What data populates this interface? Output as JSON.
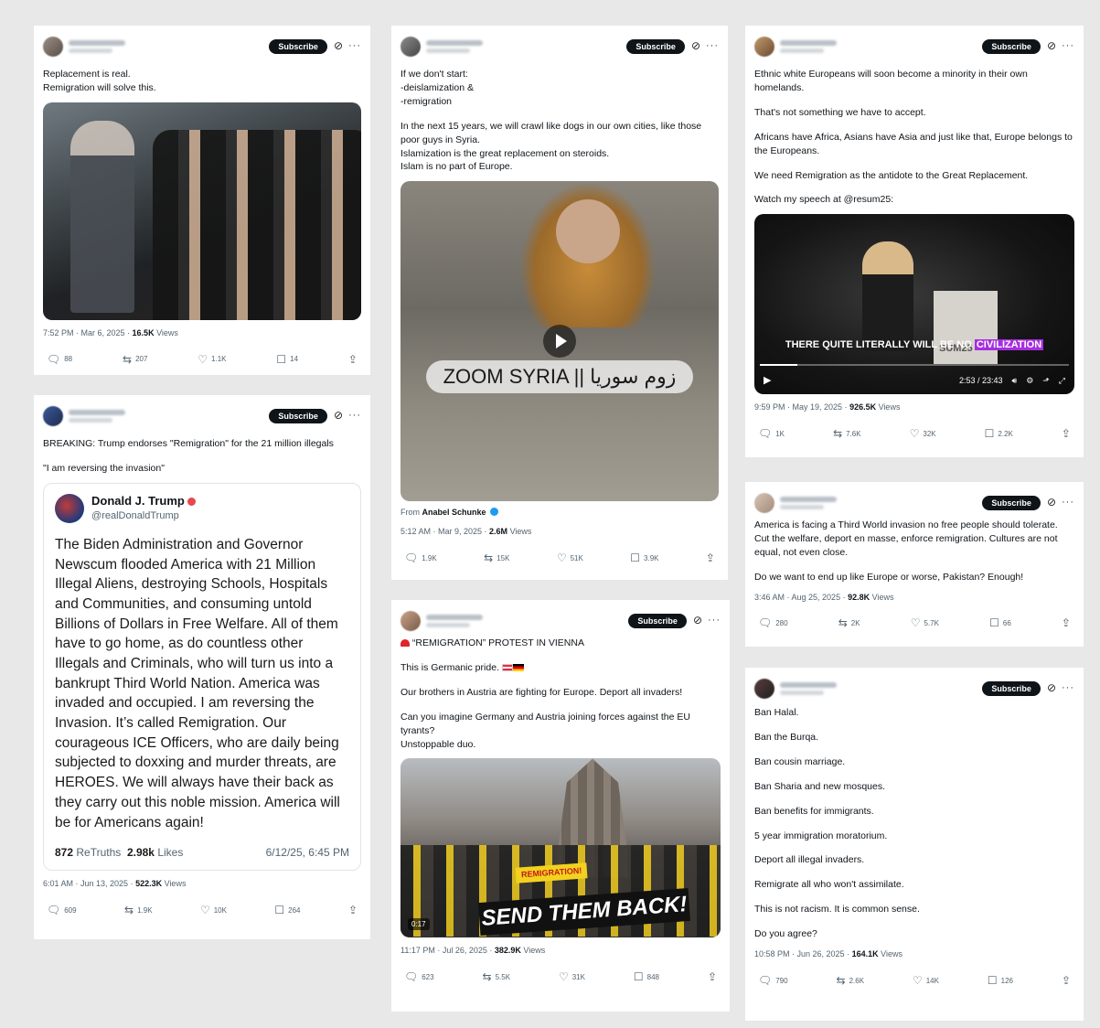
{
  "common": {
    "subscribe": "Subscribe",
    "grok_icon": "⊘",
    "more_icon": "···"
  },
  "post1": {
    "lines": [
      "Replacement is real.",
      "Remigration will solve this."
    ],
    "time": "7:52 PM · Mar 6, 2025 · ",
    "views": "16.5K",
    "views_label": " Views",
    "replies": "88",
    "reposts": "207",
    "likes": "1.1K",
    "bookmarks": "14"
  },
  "post2": {
    "line1": "BREAKING: Trump endorses \"Remigration\" for the 21 million illegals",
    "line2": "\"I am reversing the invasion\"",
    "truth_name": "Donald J. Trump",
    "truth_handle": "@realDonaldTrump",
    "truth_text": "The Biden Administration and Governor Newscum flooded America with 21 Million Illegal Aliens, destroying Schools, Hospitals and Communities, and consuming untold Billions of Dollars in Free Welfare. All of them have to go home, as do countless other Illegals and Criminals, who will turn us into a bankrupt Third World Nation. America was invaded and occupied. I am reversing the Invasion. It’s called Remigration. Our courageous ICE Officers, who are daily being subjected to doxxing and murder threats, are HEROES. We will always have their back as they carry out this noble mission. America will be for Americans again!",
    "retruths": "872",
    "retruths_label": " ReTruths",
    "truth_likes": "2.98k",
    "truth_likes_label": " Likes",
    "truth_date": "6/12/25, 6:45 PM",
    "time": "6:01 AM · Jun 13, 2025 · ",
    "views": "522.3K",
    "views_label": " Views",
    "replies": "609",
    "reposts": "1.9K",
    "likes": "10K",
    "bookmarks": "264"
  },
  "post3": {
    "p1": "If we don't start:\n-deislamization &\n-remigration",
    "p2": "In the next 15 years, we will crawl like dogs in our own cities, like those poor guys in Syria.\nIslamization is the great replacement on steroids.\nIslam is no part of Europe.",
    "video_caption": "ZOOM SYRIA || زوم سوريا",
    "from_label": "From ",
    "from_name": "Anabel Schunke",
    "time": "5:12 AM · Mar 9, 2025 · ",
    "views": "2.6M",
    "views_label": " Views",
    "replies": "1.9K",
    "reposts": "15K",
    "likes": "51K",
    "bookmarks": "3.9K"
  },
  "post4": {
    "l1": " “REMIGRATION” PROTEST IN VIENNA",
    "l2": "This is Germanic pride. ",
    "l3": "Our brothers in Austria are fighting for Europe. Deport all invaders!",
    "l4": "Can you imagine Germany and Austria joining forces against the EU tyrants?\nUnstoppable duo.",
    "banner": "SEND THEM BACK!",
    "sign": "REMIGRATION!",
    "duration": "0:17",
    "time": "11:17 PM · Jul 26, 2025 · ",
    "views": "382.9K",
    "views_label": " Views",
    "replies": "623",
    "reposts": "5.5K",
    "likes": "31K",
    "bookmarks": "848"
  },
  "post5": {
    "p1": "Ethnic white Europeans will soon become a minority in their own homelands.",
    "p2": "That's not something we have to accept.",
    "p3": "Africans have Africa, Asians have Asia and just like that, Europe belongs to the Europeans.",
    "p4": "We need Remigration as the antidote to the Great Replacement.",
    "p5": "Watch my speech at @resum25:",
    "caption_a": "THERE QUITE LITERALLY WILL BE NO ",
    "caption_b": "CIVILIZATION",
    "video_time": "2:53 / 23:43",
    "video_progress": 0.12,
    "podium": "SUM25",
    "time": "9:59 PM · May 19, 2025 · ",
    "views": "926.5K",
    "views_label": " Views",
    "replies": "1K",
    "reposts": "7.6K",
    "likes": "32K",
    "bookmarks": "2.2K"
  },
  "post6": {
    "p1": "America is facing a Third World invasion no free people should tolerate. Cut the welfare, deport en masse, enforce remigration. Cultures are not equal, not even close.",
    "p2": "Do we want to end up like Europe or worse, Pakistan? Enough!",
    "time": "3:46 AM · Aug 25, 2025 · ",
    "views": "92.8K",
    "views_label": " Views",
    "replies": "280",
    "reposts": "2K",
    "likes": "5.7K",
    "bookmarks": "66"
  },
  "post7": {
    "lines": [
      "Ban Halal.",
      "Ban the Burqa.",
      "Ban cousin marriage.",
      "Ban Sharia and new mosques.",
      "Ban benefits for immigrants.",
      "5 year immigration moratorium.",
      "Deport all illegal invaders.",
      "Remigrate all who won't assimilate.",
      "This is not racism. It is common sense.",
      "Do you agree?"
    ],
    "time": "10:58 PM · Jun 26, 2025 · ",
    "views": "164.1K",
    "views_label": " Views",
    "replies": "790",
    "reposts": "2.6K",
    "likes": "14K",
    "bookmarks": "126"
  }
}
